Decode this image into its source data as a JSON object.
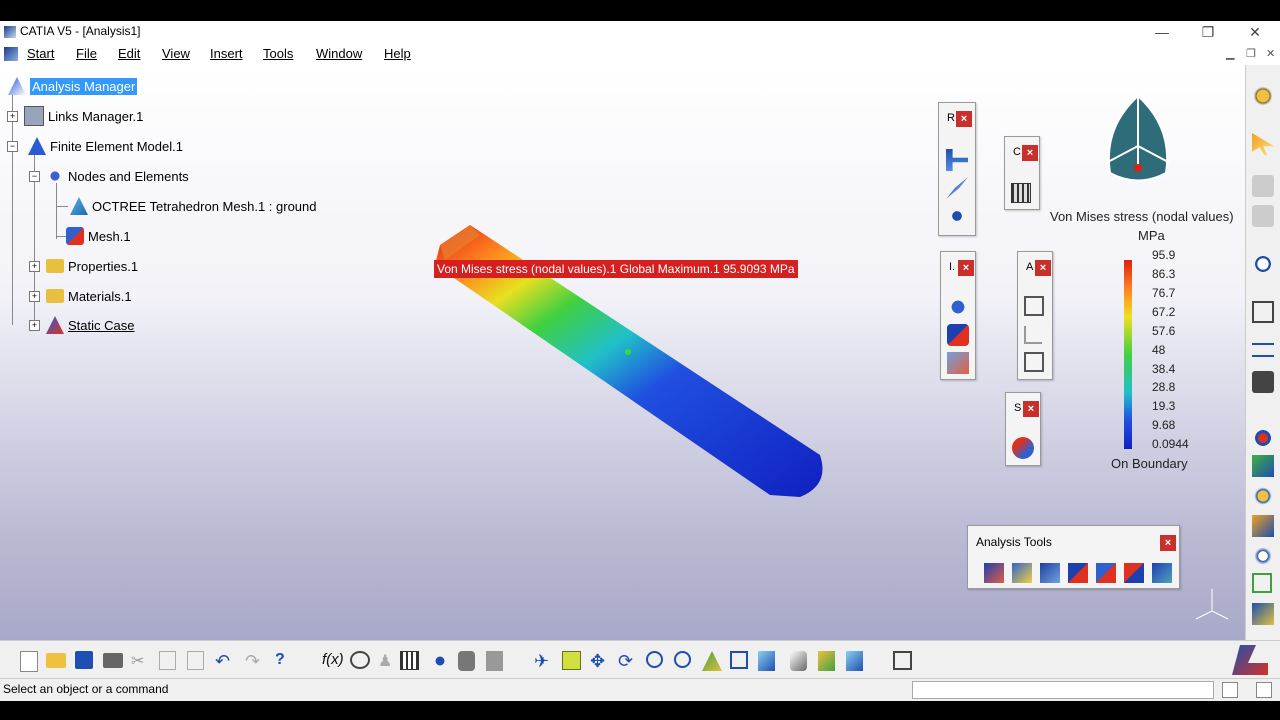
{
  "window": {
    "title": "CATIA V5 - [Analysis1]",
    "controls": [
      "—",
      "❐",
      "✕"
    ]
  },
  "menu": [
    "Start",
    "File",
    "Edit",
    "View",
    "Insert",
    "Tools",
    "Window",
    "Help"
  ],
  "tree": {
    "root": "Analysis Manager",
    "items": [
      "Links Manager.1",
      "Finite Element Model.1",
      "Nodes and Elements",
      "OCTREE Tetrahedron Mesh.1 : ground",
      "Mesh.1",
      "Properties.1",
      "Materials.1",
      "Static Case"
    ]
  },
  "annotation": {
    "label": "Von Mises stress (nodal values).1  Global Maximum.1  95.9093 MPa"
  },
  "toolbars": {
    "r_label": "R",
    "c_label": "C",
    "i_label": "I.",
    "a_label": "A",
    "s_label": "S",
    "analysis_tools": "Analysis Tools",
    "close": "×"
  },
  "legend": {
    "title": "Von Mises stress (nodal values)",
    "unit": "MPa",
    "values": [
      "95.9",
      "86.3",
      "76.7",
      "67.2",
      "57.6",
      "48",
      "38.4",
      "28.8",
      "19.3",
      "9.68",
      "0.0944"
    ],
    "footer": "On Boundary"
  },
  "status": {
    "text": "Select an object or a command"
  },
  "colors": {
    "accent": "#c9302c",
    "selection": "#3399ff"
  }
}
